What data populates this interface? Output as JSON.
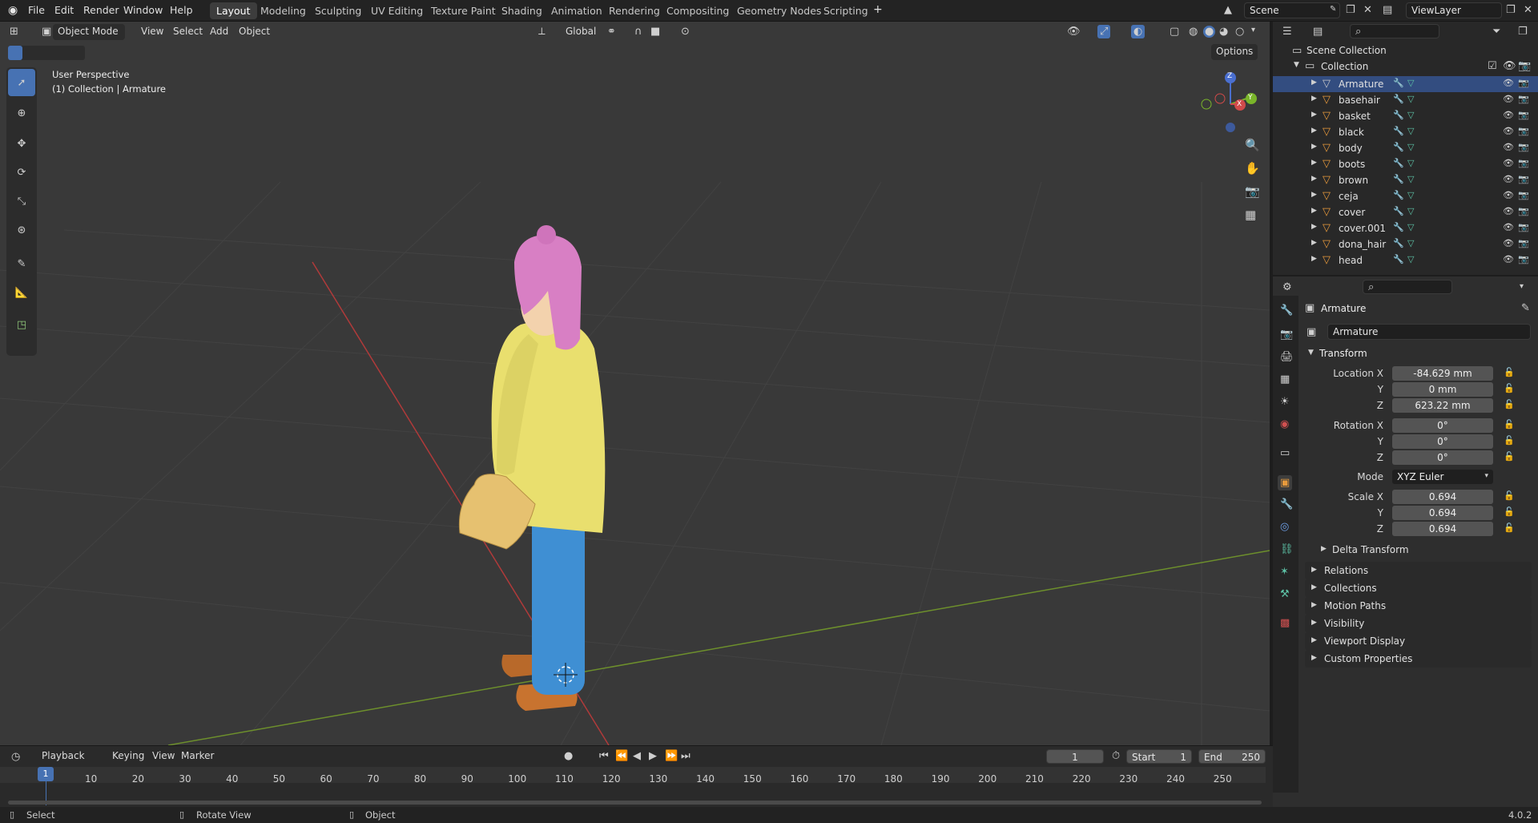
{
  "topbar": {
    "menus": [
      "File",
      "Edit",
      "Render",
      "Window",
      "Help"
    ],
    "workspaces": [
      "Layout",
      "Modeling",
      "Sculpting",
      "UV Editing",
      "Texture Paint",
      "Shading",
      "Animation",
      "Rendering",
      "Compositing",
      "Geometry Nodes",
      "Scripting"
    ],
    "active_workspace": "Layout",
    "add_tab": "+",
    "scene": "Scene",
    "view_layer": "ViewLayer"
  },
  "viewport": {
    "mode": "Object Mode",
    "menus": [
      "View",
      "Select",
      "Add",
      "Object"
    ],
    "orientation": "Global",
    "options": "Options",
    "perspective": "User Perspective",
    "context": "(1) Collection | Armature",
    "gizmo_axes": [
      "Z",
      "Y",
      "X"
    ]
  },
  "outliner": {
    "root": "Scene Collection",
    "collection": "Collection",
    "items": [
      {
        "name": "Armature",
        "selected": true
      },
      {
        "name": "basehair"
      },
      {
        "name": "basket"
      },
      {
        "name": "black"
      },
      {
        "name": "body"
      },
      {
        "name": "boots"
      },
      {
        "name": "brown"
      },
      {
        "name": "ceja"
      },
      {
        "name": "cover"
      },
      {
        "name": "cover.001"
      },
      {
        "name": "dona_hair"
      },
      {
        "name": "head"
      }
    ]
  },
  "properties": {
    "object_name": "Armature",
    "datablock": "Armature",
    "transform": "Transform",
    "location_label": "Location X",
    "location": {
      "x": "-84.629 mm",
      "y": "0 mm",
      "z": "623.22 mm"
    },
    "rotation_label": "Rotation X",
    "rotation": {
      "x": "0°",
      "y": "0°",
      "z": "0°"
    },
    "mode_label": "Mode",
    "mode": "XYZ Euler",
    "scale_label": "Scale X",
    "scale": {
      "x": "0.694",
      "y": "0.694",
      "z": "0.694"
    },
    "y": "Y",
    "z": "Z",
    "delta": "Delta Transform",
    "sections": [
      "Relations",
      "Collections",
      "Motion Paths",
      "Visibility",
      "Viewport Display",
      "Custom Properties"
    ]
  },
  "timeline": {
    "menus": [
      "Playback",
      "Keying",
      "View",
      "Marker"
    ],
    "current_frame": "1",
    "start_label": "Start",
    "start": "1",
    "end_label": "End",
    "end": "250",
    "ruler": [
      "10",
      "20",
      "30",
      "40",
      "50",
      "60",
      "70",
      "80",
      "90",
      "100",
      "110",
      "120",
      "130",
      "140",
      "150",
      "160",
      "170",
      "180",
      "190",
      "200",
      "210",
      "220",
      "230",
      "240",
      "250"
    ],
    "playhead": "1"
  },
  "statusbar": {
    "select": "Select",
    "rotate": "Rotate View",
    "object": "Object",
    "version": "4.0.2"
  },
  "colors": {
    "accent": "#4772b3",
    "viewport_bg": "#393939",
    "x_axis": "#c93b3b",
    "y_axis": "#7a9a32",
    "hair": "#d87fc4",
    "sweater": "#e9df6e",
    "pants": "#3f8fd3",
    "boots": "#c8732f",
    "basket": "#e6c170"
  }
}
